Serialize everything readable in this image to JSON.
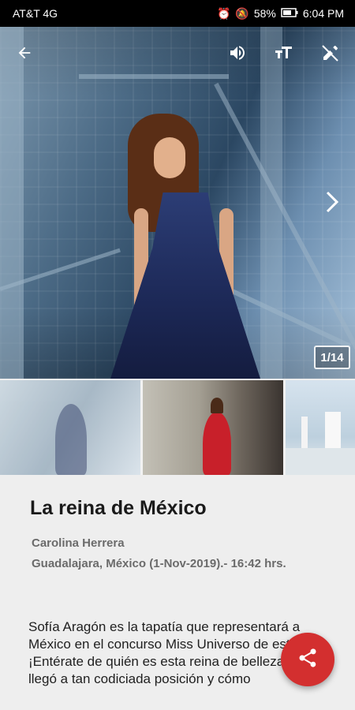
{
  "status_bar": {
    "carrier": "AT&T 4G",
    "battery": "58%",
    "time": "6:04 PM"
  },
  "gallery": {
    "counter": "1/14",
    "icons": {
      "back": "arrow-left-icon",
      "sound": "volume-icon",
      "text_size": "text-size-icon",
      "edit": "edit-off-icon",
      "next": "chevron-right-icon"
    }
  },
  "article": {
    "title": "La reina de México",
    "author": "Carolina Herrera",
    "dateline": "Guadalajara, México (1-Nov-2019).- 16:42 hrs.",
    "body": "Sofía Aragón es la tapatía que representará a México en el concurso Miss Universo de este año. ¡Entérate de quién es esta reina de belleza, cómo llegó a tan codiciada posición y cómo"
  },
  "share_button": {
    "icon": "share-icon",
    "color": "#d32f2f"
  }
}
